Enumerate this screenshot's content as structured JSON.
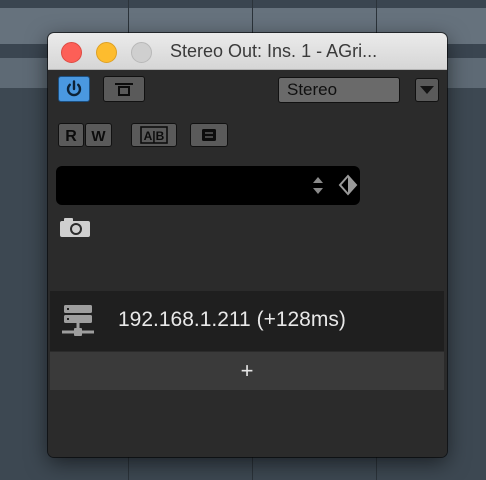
{
  "window": {
    "title": "Stereo Out: Ins. 1 - AGri..."
  },
  "toolbar": {
    "preset_selector_value": "Stereo",
    "read_label": "R",
    "write_label": "W",
    "ab_label": "A|B"
  },
  "server": {
    "address": "192.168.1.211 (+128ms)",
    "add_label": "+"
  },
  "colors": {
    "power_active": "#4a98e0",
    "close_light": "#fd5f57",
    "minimize_light": "#fdbc2e"
  }
}
